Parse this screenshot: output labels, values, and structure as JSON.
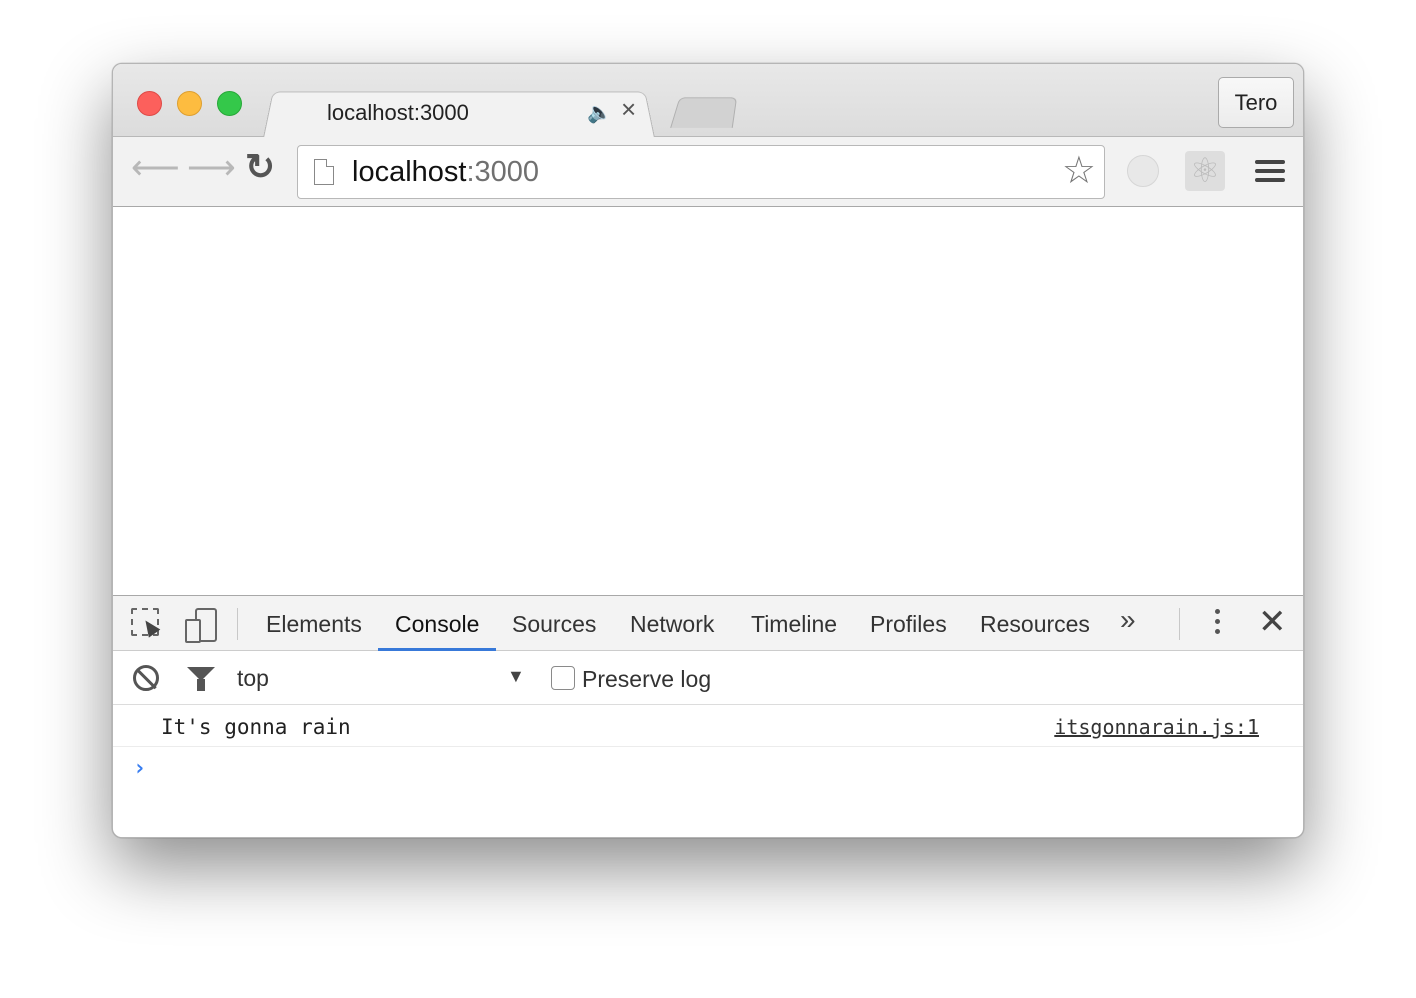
{
  "tab": {
    "title": "localhost:3000",
    "audio_icon": "speaker-icon",
    "close_icon": "close-icon"
  },
  "profile": {
    "name": "Tero"
  },
  "address_bar": {
    "host": "localhost",
    "port": ":3000"
  },
  "devtools": {
    "tabs": [
      "Elements",
      "Console",
      "Sources",
      "Network",
      "Timeline",
      "Profiles",
      "Resources"
    ],
    "active_tab": "Console",
    "more_glyph": "»",
    "close_glyph": "✕"
  },
  "console": {
    "context": "top",
    "preserve_log_label": "Preserve log",
    "preserve_log_checked": false,
    "messages": [
      {
        "text": "It's gonna rain",
        "source": "itsgonnarain.js:1"
      }
    ],
    "prompt": "›"
  },
  "colors": {
    "accent": "#3879d9",
    "prompt": "#367cf1",
    "traffic_red": "#fc605c",
    "traffic_yellow": "#fdbc40",
    "traffic_green": "#34c84a"
  }
}
